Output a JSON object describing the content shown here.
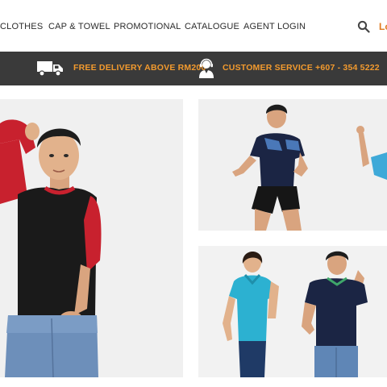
{
  "nav": {
    "items": [
      {
        "label": "CLOTHES"
      },
      {
        "label": "CAP & TOWEL"
      },
      {
        "label": "PROMOTIONAL"
      },
      {
        "label": "CATALOGUE"
      },
      {
        "label": "AGENT LOGIN"
      }
    ],
    "login_label": "Lo",
    "search_icon": "search-icon"
  },
  "promo": {
    "delivery_text": "FREE DELIVERY ABOVE RM200",
    "service_text": "CUSTOMER SERVICE +607 - 354 5222",
    "text_color": "#f29a2e",
    "background": "#3a3a3a",
    "icons": [
      "truck-icon",
      "customer-service-agent-icon"
    ]
  },
  "gallery": {
    "panels": [
      {
        "name": "model-raglan-tee"
      },
      {
        "name": "model-sports-tee"
      },
      {
        "name": "models-polo-shirts"
      }
    ]
  },
  "colors": {
    "accent": "#e07a1f",
    "nav_text": "#2b2b2b",
    "panel_bg": "#f0f0f0"
  }
}
